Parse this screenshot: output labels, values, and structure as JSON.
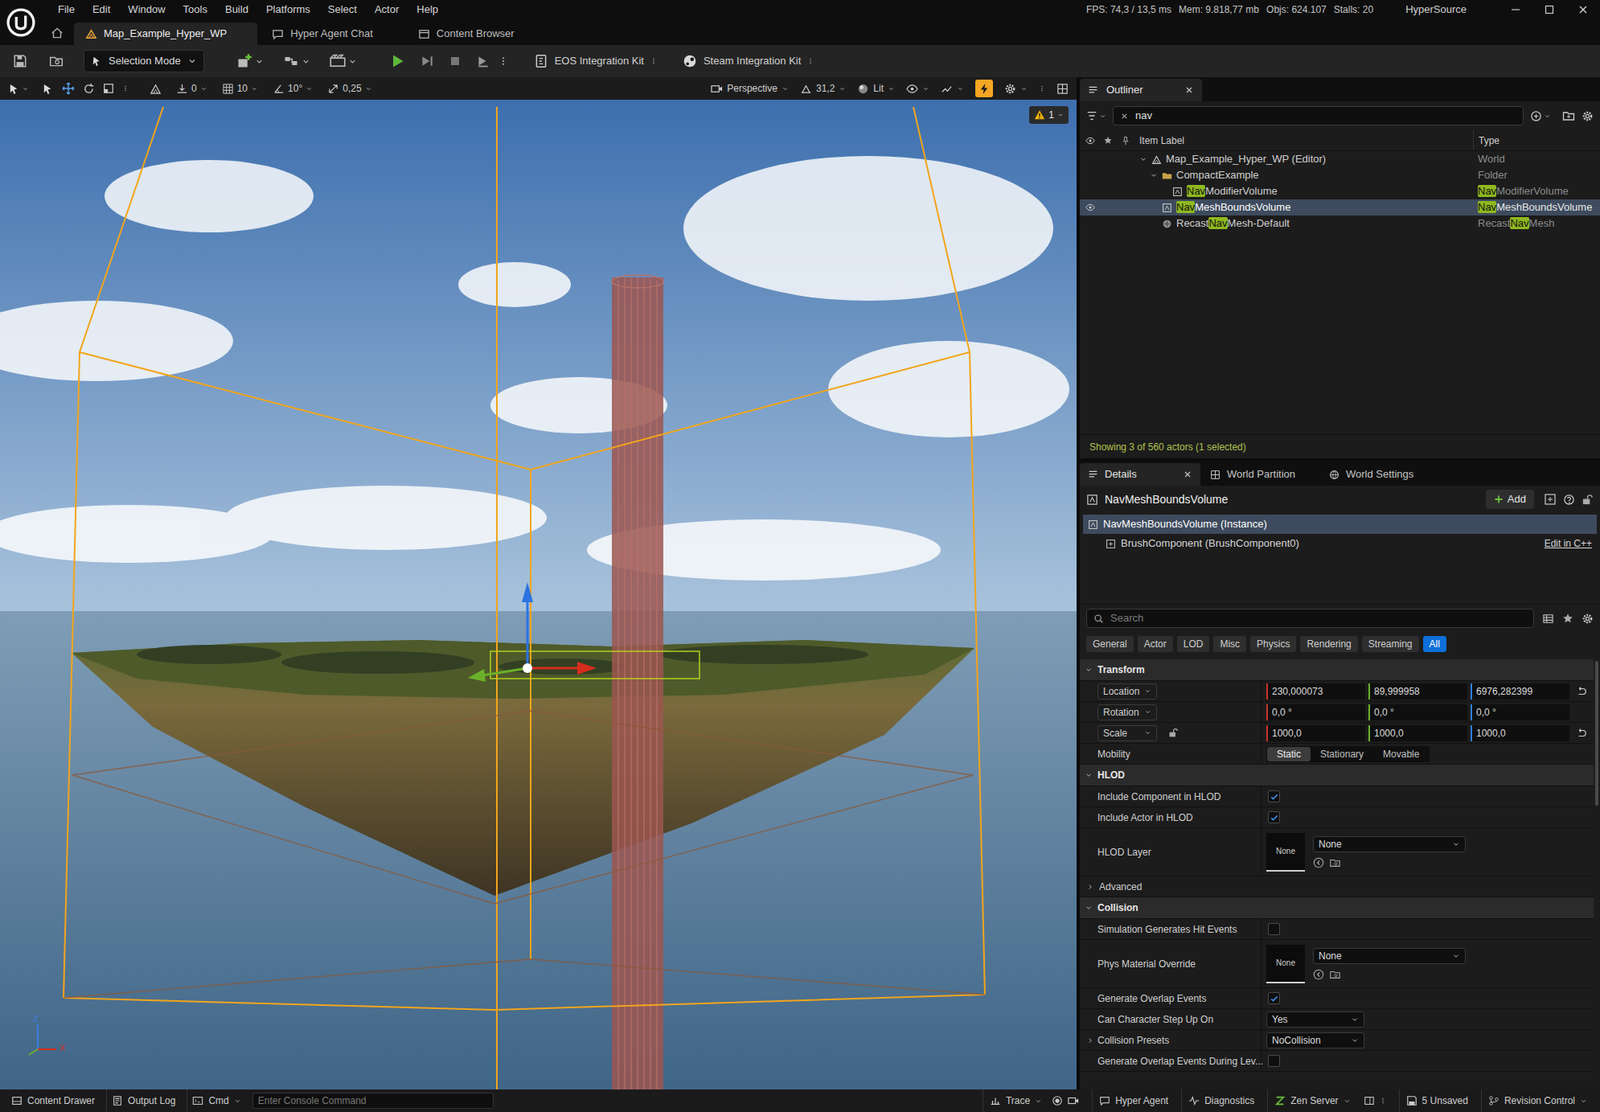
{
  "window": {
    "menu": [
      "File",
      "Edit",
      "Window",
      "Tools",
      "Build",
      "Platforms",
      "Select",
      "Actor",
      "Help"
    ],
    "tabs": [
      {
        "label": "Map_Example_Hyper_WP",
        "selected": true
      },
      {
        "label": "Hyper Agent Chat",
        "selected": false
      },
      {
        "label": "Content Browser",
        "selected": false
      }
    ],
    "stats": [
      "FPS: 74,3 / 13,5 ms",
      "Mem: 9.818,77 mb",
      "Objs: 624.107",
      "Stalls: 20"
    ],
    "project": "HyperSource"
  },
  "toolbar": {
    "mode": "Selection Mode",
    "plugins": [
      "EOS Integration Kit",
      "Steam Integration Kit"
    ]
  },
  "viewport": {
    "snaps": [
      "0",
      "10",
      "10°",
      "0,25"
    ],
    "view": "Perspective",
    "fov": "31,2",
    "lighting": "Lit",
    "warnings": "1",
    "axes": [
      "Z",
      "X"
    ]
  },
  "outliner": {
    "title": "Outliner",
    "closable": true,
    "search": "nav",
    "columns": [
      "Item Label",
      "Type"
    ],
    "rows": [
      {
        "kind": "world",
        "depth": 0,
        "expanded": true,
        "selected": false,
        "visible": false,
        "label": [
          {
            "text": "Map_Example_Hyper_WP (Editor)",
            "match": false
          }
        ],
        "type": [
          {
            "text": "World",
            "match": false
          }
        ]
      },
      {
        "kind": "folder",
        "depth": 1,
        "expanded": true,
        "selected": false,
        "visible": false,
        "label": [
          {
            "text": "CompactExample",
            "match": false
          }
        ],
        "type": [
          {
            "text": "Folder",
            "match": false
          }
        ]
      },
      {
        "kind": "volume",
        "depth": 2,
        "selected": false,
        "visible": false,
        "label": [
          {
            "text": "Nav",
            "match": true
          },
          {
            "text": "ModifierVolume",
            "match": false
          }
        ],
        "type": [
          {
            "text": "Nav",
            "match": true
          },
          {
            "text": "ModifierVolume",
            "match": false
          }
        ]
      },
      {
        "kind": "volume",
        "depth": 1,
        "selected": true,
        "visible": true,
        "label": [
          {
            "text": "Nav",
            "match": true
          },
          {
            "text": "MeshBoundsVolume",
            "match": false
          }
        ],
        "type": [
          {
            "text": "Nav",
            "match": true
          },
          {
            "text": "MeshBoundsVolume",
            "match": false
          }
        ]
      },
      {
        "kind": "navmesh",
        "depth": 1,
        "selected": false,
        "visible": false,
        "label": [
          {
            "text": "Recast",
            "match": false
          },
          {
            "text": "Nav",
            "match": true
          },
          {
            "text": "Mesh-Default",
            "match": false
          }
        ],
        "type": [
          {
            "text": "Recast",
            "match": false
          },
          {
            "text": "Nav",
            "match": true
          },
          {
            "text": "Mesh",
            "match": false
          }
        ]
      }
    ],
    "footer": "Showing 3 of 560 actors (1 selected)"
  },
  "details": {
    "tabs": [
      {
        "label": "Details",
        "selected": true,
        "closable": true
      },
      {
        "label": "World Partition",
        "selected": false,
        "closable": false
      },
      {
        "label": "World Settings",
        "selected": false,
        "closable": false
      }
    ],
    "actor": "NavMeshBoundsVolume",
    "add": "Add",
    "components": [
      {
        "label": "NavMeshBoundsVolume (Instance)",
        "selected": true
      },
      {
        "label": "BrushComponent (BrushComponent0)",
        "selected": false
      }
    ],
    "edit_link": "Edit in C++",
    "search_placeholder": "Search",
    "filters": [
      {
        "label": "General",
        "selected": false
      },
      {
        "label": "Actor",
        "selected": false
      },
      {
        "label": "LOD",
        "selected": false
      },
      {
        "label": "Misc",
        "selected": false
      },
      {
        "label": "Physics",
        "selected": false
      },
      {
        "label": "Rendering",
        "selected": false
      },
      {
        "label": "Streaming",
        "selected": false
      },
      {
        "label": "All",
        "selected": true
      }
    ],
    "sections": [
      {
        "title": "Transform",
        "expanded": true,
        "rows": [
          {
            "kind": "vector",
            "label": "Location",
            "values": [
              "230,000073",
              "89,999958",
              "6976,282399"
            ],
            "reset": true
          },
          {
            "kind": "vector",
            "label": "Rotation",
            "values": [
              "0,0 °",
              "0,0 °",
              "0,0 °"
            ],
            "reset": false
          },
          {
            "kind": "vector",
            "label": "Scale",
            "values": [
              "1000,0",
              "1000,0",
              "1000,0"
            ],
            "reset": true,
            "locked": false
          },
          {
            "kind": "radio",
            "label": "Mobility",
            "options": [
              {
                "label": "Static",
                "selected": true
              },
              {
                "label": "Stationary",
                "selected": false
              },
              {
                "label": "Movable",
                "selected": false
              }
            ]
          }
        ]
      },
      {
        "title": "HLOD",
        "expanded": true,
        "rows": [
          {
            "kind": "checkbox",
            "label": "Include Component in HLOD",
            "checked": true
          },
          {
            "kind": "checkbox",
            "label": "Include Actor in HLOD",
            "checked": true
          },
          {
            "kind": "asset",
            "label": "HLOD Layer",
            "thumb": "None",
            "value": "None"
          },
          {
            "kind": "subsection",
            "label": "Advanced",
            "expanded": false
          }
        ]
      },
      {
        "title": "Collision",
        "expanded": true,
        "rows": [
          {
            "kind": "checkbox",
            "label": "Simulation Generates Hit Events",
            "checked": false
          },
          {
            "kind": "asset",
            "label": "Phys Material Override",
            "thumb": "None",
            "value": "None"
          },
          {
            "kind": "checkbox",
            "label": "Generate Overlap Events",
            "checked": true
          },
          {
            "kind": "dropdown",
            "label": "Can Character Step Up On",
            "value": "Yes"
          },
          {
            "kind": "dropdown",
            "label": "Collision Presets",
            "value": "NoCollision",
            "expanded": false
          },
          {
            "kind": "checkbox",
            "label": "Generate Overlap Events During Lev...",
            "checked": false
          }
        ]
      }
    ]
  },
  "status_bar": {
    "left": [
      "Content Drawer",
      "Output Log",
      "Cmd"
    ],
    "console_placeholder": "Enter Console Command",
    "right": [
      "Trace",
      "Hyper Agent",
      "Diagnostics",
      "Zen Server",
      "5 Unsaved",
      "Revision Control"
    ]
  }
}
